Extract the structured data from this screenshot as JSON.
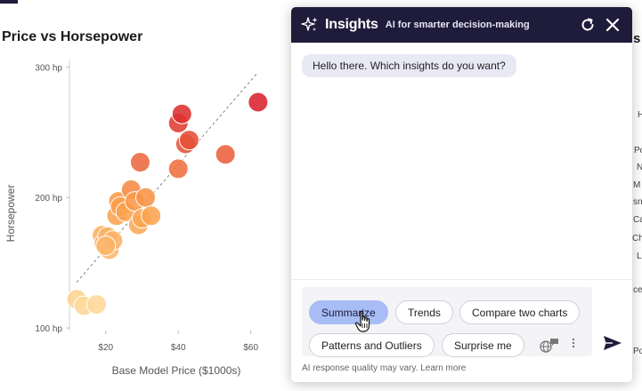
{
  "app": {
    "chart_title": "Price vs Horsepower"
  },
  "chart_data": {
    "type": "scatter",
    "title": "Price vs Horsepower",
    "xlabel": "Base Model Price ($1000s)",
    "ylabel": "Horsepower",
    "xlim": [
      10,
      64
    ],
    "ylim": [
      98,
      305
    ],
    "x_ticks": [
      20,
      40,
      60
    ],
    "x_tick_labels": [
      "$20",
      "$40",
      "$60"
    ],
    "y_ticks": [
      100,
      200,
      300
    ],
    "y_tick_labels": [
      "100 hp",
      "200 hp",
      "300 hp"
    ],
    "trendline": {
      "from": [
        12,
        135
      ],
      "to": [
        62,
        296
      ]
    },
    "points": [
      {
        "x": 12,
        "y": 122
      },
      {
        "x": 14,
        "y": 117
      },
      {
        "x": 17.5,
        "y": 118
      },
      {
        "x": 19,
        "y": 171
      },
      {
        "x": 19.5,
        "y": 165
      },
      {
        "x": 20.5,
        "y": 170
      },
      {
        "x": 21,
        "y": 160
      },
      {
        "x": 22,
        "y": 167
      },
      {
        "x": 20,
        "y": 163
      },
      {
        "x": 23,
        "y": 186
      },
      {
        "x": 23.5,
        "y": 197
      },
      {
        "x": 24,
        "y": 193
      },
      {
        "x": 25.5,
        "y": 189
      },
      {
        "x": 27,
        "y": 206
      },
      {
        "x": 28,
        "y": 197
      },
      {
        "x": 29,
        "y": 179
      },
      {
        "x": 30,
        "y": 184
      },
      {
        "x": 31,
        "y": 200
      },
      {
        "x": 32.5,
        "y": 186
      },
      {
        "x": 29.5,
        "y": 227
      },
      {
        "x": 40,
        "y": 222
      },
      {
        "x": 40,
        "y": 257
      },
      {
        "x": 41,
        "y": 264
      },
      {
        "x": 42,
        "y": 241
      },
      {
        "x": 43,
        "y": 244
      },
      {
        "x": 53,
        "y": 233
      },
      {
        "x": 62,
        "y": 273
      }
    ],
    "color_scale": {
      "low": "#fddda0",
      "mid": "#fb9f4a",
      "high": "#d81f2c"
    },
    "grid": false
  },
  "panel": {
    "title": "Insights",
    "subtitle": "AI for smarter decision-making",
    "header_icon": "sparkle-icon",
    "refresh_icon": "refresh-icon",
    "close_icon": "close-icon",
    "greeting": "Hello there. Which insights do you want?",
    "chips": [
      "Summarize",
      "Trends",
      "Compare two charts",
      "Patterns and Outliers",
      "Surprise me"
    ],
    "active_chip": "Summarize",
    "language_icon": "globe-chat-icon",
    "more_icon": "kebab-icon",
    "send_icon": "send-icon",
    "disclaimer": "AI response quality may vary. Learn more"
  },
  "background_fragments": {
    "right_title_letter": "s",
    "right_labels": [
      "H",
      "Po",
      "N",
      "M",
      "sn",
      "Ca",
      "Ch",
      "L",
      "ce",
      "Po"
    ]
  },
  "colors": {
    "header_bg": "#1f1c3b",
    "chip_active": "#a8bcf5",
    "bubble_bg": "#e9e9f6",
    "send_color": "#1f1c3b"
  }
}
